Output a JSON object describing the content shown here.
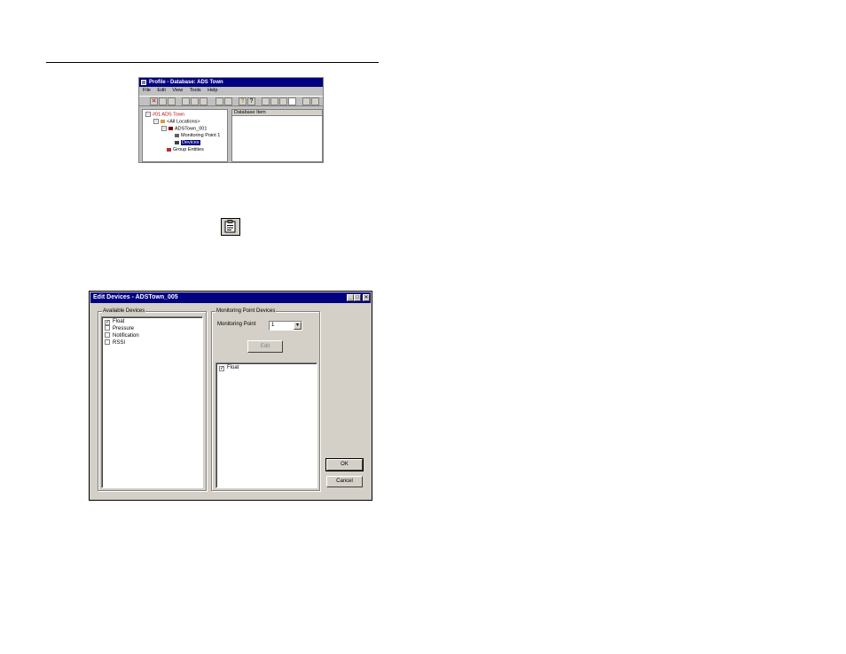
{
  "profile_window": {
    "title": "Profile - Database: ADS Town",
    "menu": [
      "File",
      "Edit",
      "View",
      "Tools",
      "Help"
    ],
    "tree": {
      "root": "#01 ADS Town",
      "all_locations": "<All Locations>",
      "location": "ADSTown_001",
      "monitoring_point": "Monitoring Point 1",
      "devices": "Devices",
      "group_entities": "Group Entities"
    },
    "list_header": "Database Item"
  },
  "dialog": {
    "title": "Edit Devices - ADSTown_005",
    "available_devices": {
      "label": "Available Devices",
      "items": [
        {
          "label": "Float",
          "checked": true
        },
        {
          "label": "Pressure",
          "checked": false
        },
        {
          "label": "Notification",
          "checked": false
        },
        {
          "label": "RSSI",
          "checked": false
        }
      ]
    },
    "monitoring_point_devices": {
      "label": "Monitoring Point Devices",
      "monitoring_point_label": "Monitoring Point",
      "monitoring_point_value": "1",
      "edit_label": "Edit",
      "items": [
        {
          "label": "Float",
          "checked": true
        }
      ]
    },
    "ok_label": "OK",
    "cancel_label": "Cancel"
  }
}
